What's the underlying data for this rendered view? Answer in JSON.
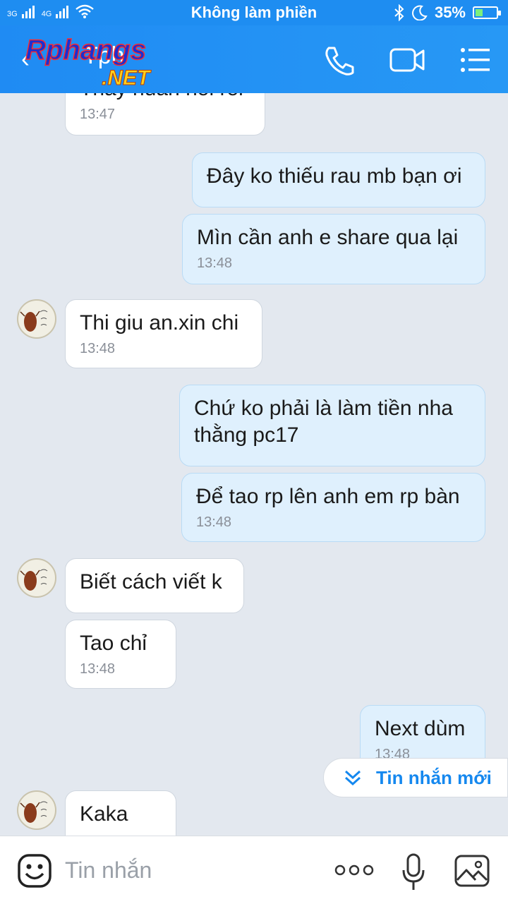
{
  "status_bar": {
    "net1": "3G",
    "net2": "4G",
    "title": "Không làm phiền",
    "battery": "35%",
    "battery_level": 0.35
  },
  "header": {
    "contact_name": "Tph",
    "watermark_text": "Rphangs .NET",
    "back_icon": "arrow-left-icon",
    "call_icon": "phone-icon",
    "video_icon": "video-camera-icon",
    "menu_icon": "list-menu-icon"
  },
  "messages": [
    {
      "dir": "in",
      "text": "Thấy nuan nói rồi",
      "time": "13:47"
    },
    {
      "dir": "out",
      "text": "Đây ko thiếu rau mb bạn ơi",
      "time": ""
    },
    {
      "dir": "out",
      "text": "Mìn cần anh e share qua lại",
      "time": "13:48"
    },
    {
      "dir": "in",
      "text": "Thi giu an.xin chi",
      "time": "13:48"
    },
    {
      "dir": "out",
      "text": "Chứ ko phải là làm tiền nha thằng pc17",
      "time": ""
    },
    {
      "dir": "out",
      "text": "Để tao rp lên anh em rp bàn",
      "time": "13:48"
    },
    {
      "dir": "in",
      "text": "Biết cách viết k",
      "time": ""
    },
    {
      "dir": "in",
      "text": "Tao chỉ",
      "time": "13:48"
    },
    {
      "dir": "out",
      "text": "Next dùm",
      "time": "13:48"
    },
    {
      "dir": "in",
      "text": "Kaka",
      "time": ""
    }
  ],
  "new_messages_button": "Tin nhắn mới",
  "composer": {
    "placeholder": "Tin nhắn",
    "emoji_icon": "emoji-icon",
    "more_icon": "more-dots-icon",
    "mic_icon": "microphone-icon",
    "image_icon": "image-icon"
  },
  "colors": {
    "header": "#2196f3",
    "outgoing_bubble": "#dff0fd",
    "incoming_bubble": "#ffffff",
    "background": "#e3e8ef",
    "accent": "#1588ef"
  }
}
